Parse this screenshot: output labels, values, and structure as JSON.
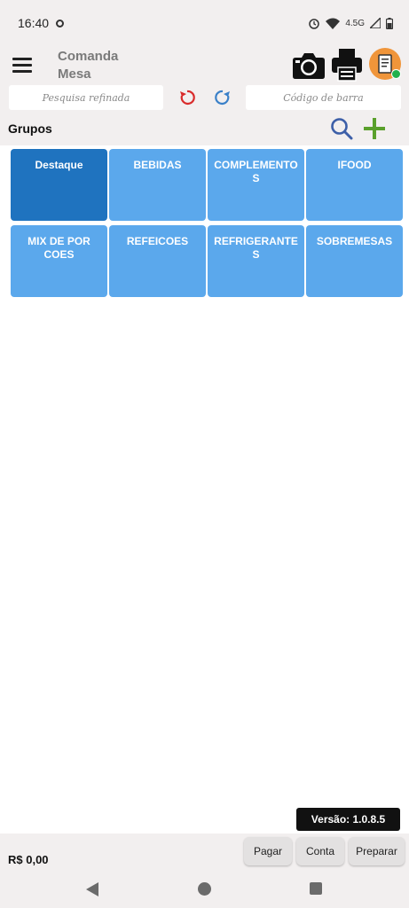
{
  "status_bar": {
    "time": "16:40",
    "network_label": "4.5G"
  },
  "app_bar": {
    "title_line1": "Comanda",
    "title_line2": "Mesa"
  },
  "search_bar": {
    "refined_search_placeholder": "Pesquisa refinada",
    "barcode_placeholder": "Código de barra"
  },
  "groups": {
    "label": "Grupos",
    "items": [
      {
        "label": "Destaque",
        "active": true
      },
      {
        "label": "BEBIDAS",
        "active": false
      },
      {
        "label": "COMPLEMENTOS",
        "active": false
      },
      {
        "label": "IFOOD",
        "active": false
      },
      {
        "label": "MIX DE PORCOES",
        "active": false
      },
      {
        "label": "REFEICOES",
        "active": false
      },
      {
        "label": "REFRIGERANTES",
        "active": false
      },
      {
        "label": "SOBREMESAS",
        "active": false
      }
    ]
  },
  "footer": {
    "version": "Versão: 1.0.8.5",
    "total": "R$ 0,00",
    "pay_label": "Pagar",
    "account_label": "Conta",
    "prepare_label": "Preparar"
  },
  "icons": {
    "menu": "menu-icon",
    "camera": "camera-icon",
    "printer": "printer-icon",
    "undo": "undo-icon",
    "refresh": "refresh-icon",
    "search": "search-icon",
    "add": "plus-icon"
  },
  "colors": {
    "tile": "#5ba8ec",
    "tile_active": "#1f73bf",
    "undo": "#d92b2b",
    "refresh": "#3a80c8",
    "search": "#3d5fa8",
    "add": "#5aa02c",
    "avatar": "#f0953a"
  }
}
